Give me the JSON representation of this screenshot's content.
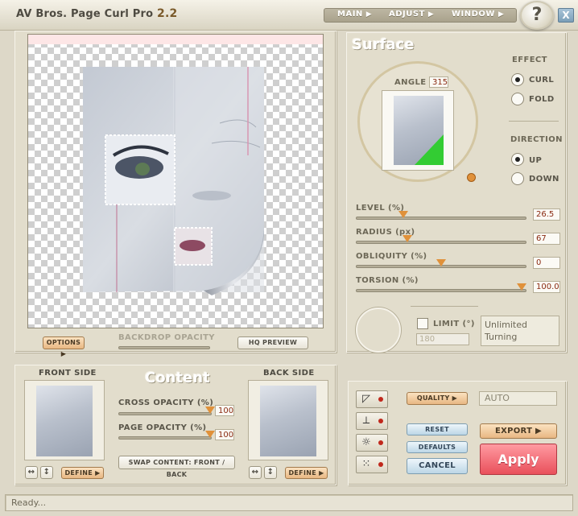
{
  "app": {
    "title": "AV Bros. Page Curl Pro",
    "version": "2.2"
  },
  "menu": [
    {
      "label": "MAIN"
    },
    {
      "label": "ADJUST"
    },
    {
      "label": "WINDOW"
    }
  ],
  "help_label": "?",
  "close_label": "X",
  "preview": {
    "options_label": "OPTIONS",
    "backdrop_opacity_label": "BACKDROP OPACITY",
    "hq_preview_label": "HQ PREVIEW"
  },
  "surface": {
    "title": "Surface",
    "angle_label": "ANGLE",
    "angle_value": "315",
    "effect_label": "EFFECT",
    "effect_options": [
      {
        "label": "CURL",
        "selected": true
      },
      {
        "label": "FOLD",
        "selected": false
      }
    ],
    "direction_label": "DIRECTION",
    "direction_options": [
      {
        "label": "UP",
        "selected": true
      },
      {
        "label": "DOWN",
        "selected": false
      }
    ],
    "sliders": [
      {
        "label": "LEVEL (%)",
        "value": "26.5",
        "fraction": 0.265
      },
      {
        "label": "RADIUS (px)",
        "value": "67",
        "fraction": 0.29
      },
      {
        "label": "OBLIQUITY (%)",
        "value": "0",
        "fraction": 0.5
      },
      {
        "label": "TORSION (%)",
        "value": "100.0",
        "fraction": 1.0
      }
    ],
    "limit_label": "LIMIT (°)",
    "limit_value": "180",
    "limit_checked": false,
    "limit_status": "Unlimited Turning"
  },
  "content": {
    "title": "Content",
    "front_side_label": "FRONT SIDE",
    "back_side_label": "BACK SIDE",
    "cross_opacity_label": "CROSS OPACITY (%)",
    "cross_opacity_value": "100",
    "page_opacity_label": "PAGE OPACITY (%)",
    "page_opacity_value": "100",
    "swap_label": "SWAP CONTENT: FRONT / BACK",
    "define_label": "DEFINE",
    "flip_h_glyph": "↔",
    "flip_v_glyph": "↕"
  },
  "actions": {
    "quality_label": "QUALITY",
    "quality_value": "AUTO",
    "reset_label": "RESET",
    "defaults_label": "DEFAULTS",
    "cancel_label": "CANCEL",
    "export_label": "EXPORT",
    "apply_label": "Apply"
  },
  "status": {
    "text": "Ready..."
  },
  "colors": {
    "accent_orange": "#e0913a",
    "apply_red": "#ef5b64",
    "curl_green": "#33cc33",
    "value_text": "#8a2a12"
  }
}
